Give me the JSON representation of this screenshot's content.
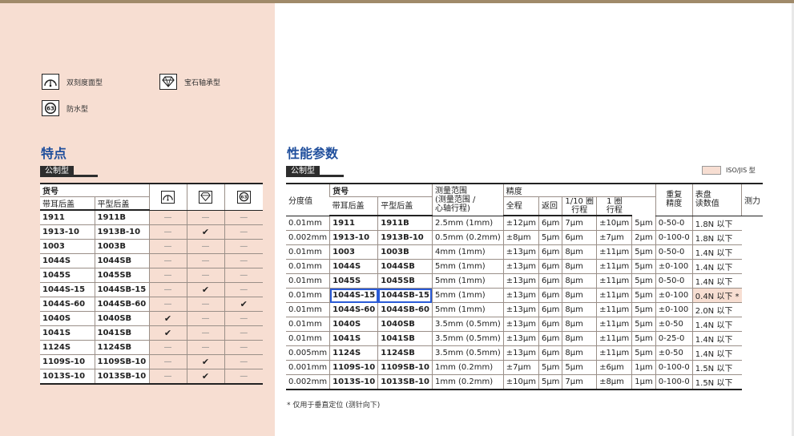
{
  "legend": {
    "dual": "双刻度面型",
    "jewel": "宝石轴承型",
    "water": "防水型"
  },
  "features": {
    "title": "特点",
    "tag": "公制型",
    "headers": {
      "part_no": "货号",
      "lug_back": "带耳后盖",
      "flat_back": "平型后盖"
    },
    "rows": [
      {
        "lug": "1911",
        "flat": "1911B",
        "dual": "—",
        "jewel": "—",
        "water": "—"
      },
      {
        "lug": "1913-10",
        "flat": "1913B-10",
        "dual": "—",
        "jewel": "✔",
        "water": "—"
      },
      {
        "lug": "1003",
        "flat": "1003B",
        "dual": "—",
        "jewel": "—",
        "water": "—"
      },
      {
        "lug": "1044S",
        "flat": "1044SB",
        "dual": "—",
        "jewel": "—",
        "water": "—"
      },
      {
        "lug": "1045S",
        "flat": "1045SB",
        "dual": "—",
        "jewel": "—",
        "water": "—"
      },
      {
        "lug": "1044S-15",
        "flat": "1044SB-15",
        "dual": "—",
        "jewel": "✔",
        "water": "—"
      },
      {
        "lug": "1044S-60",
        "flat": "1044SB-60",
        "dual": "—",
        "jewel": "—",
        "water": "✔"
      },
      {
        "lug": "1040S",
        "flat": "1040SB",
        "dual": "✔",
        "jewel": "—",
        "water": "—"
      },
      {
        "lug": "1041S",
        "flat": "1041SB",
        "dual": "✔",
        "jewel": "—",
        "water": "—"
      },
      {
        "lug": "1124S",
        "flat": "1124SB",
        "dual": "—",
        "jewel": "—",
        "water": "—"
      },
      {
        "lug": "1109S-10",
        "flat": "1109SB-10",
        "dual": "—",
        "jewel": "✔",
        "water": "—"
      },
      {
        "lug": "1013S-10",
        "flat": "1013SB-10",
        "dual": "—",
        "jewel": "✔",
        "water": "—"
      }
    ]
  },
  "specs": {
    "title": "性能参数",
    "tag": "公制型",
    "iso_legend": "ISO/JIS 型",
    "headers": {
      "graduation": "分度值",
      "part_no": "货号",
      "lug_back": "带耳后盖",
      "flat_back": "平型后盖",
      "range_l1": "测量范围",
      "range_l2": "(测量范围 /",
      "range_l3": "心轴行程)",
      "accuracy": "精度",
      "total": "全程",
      "retrace": "返回",
      "tenth_l1": "1/10 圈",
      "tenth_l2": "行程",
      "one_l1": "1 圈",
      "one_l2": "行程",
      "repeat_l1": "重复",
      "repeat_l2": "精度",
      "dial_l1": "表盘",
      "dial_l2": "读数值",
      "force": "测力"
    },
    "rows": [
      {
        "grad": "0.01mm",
        "lug": "1911",
        "flat": "1911B",
        "range": "2.5mm (1mm)",
        "total": "±12μm",
        "ret": "6μm",
        "tenth": "7μm",
        "one": "±10μm",
        "rep": "5μm",
        "dial": "0-50-0",
        "force": "1.8N 以下"
      },
      {
        "grad": "0.002mm",
        "lug": "1913-10",
        "flat": "1913B-10",
        "range": "0.5mm (0.2mm)",
        "total": "±8μm",
        "ret": "5μm",
        "tenth": "6μm",
        "one": "±7μm",
        "rep": "2μm",
        "dial": "0-100-0",
        "force": "1.8N 以下"
      },
      {
        "grad": "0.01mm",
        "lug": "1003",
        "flat": "1003B",
        "range": "4mm (1mm)",
        "total": "±13μm",
        "ret": "6μm",
        "tenth": "8μm",
        "one": "±11μm",
        "rep": "5μm",
        "dial": "0-50-0",
        "force": "1.4N 以下"
      },
      {
        "grad": "0.01mm",
        "lug": "1044S",
        "flat": "1044SB",
        "range": "5mm (1mm)",
        "total": "±13μm",
        "ret": "6μm",
        "tenth": "8μm",
        "one": "±11μm",
        "rep": "5μm",
        "dial": "±0-100",
        "force": "1.4N 以下"
      },
      {
        "grad": "0.01mm",
        "lug": "1045S",
        "flat": "1045SB",
        "range": "5mm (1mm)",
        "total": "±13μm",
        "ret": "6μm",
        "tenth": "8μm",
        "one": "±11μm",
        "rep": "5μm",
        "dial": "0-50-0",
        "force": "1.4N 以下"
      },
      {
        "grad": "0.01mm",
        "lug": "1044S-15",
        "flat": "1044SB-15",
        "range": "5mm (1mm)",
        "total": "±13μm",
        "ret": "6μm",
        "tenth": "8μm",
        "one": "±11μm",
        "rep": "5μm",
        "dial": "±0-100",
        "force": "0.4N 以下 *"
      },
      {
        "grad": "0.01mm",
        "lug": "1044S-60",
        "flat": "1044SB-60",
        "range": "5mm (1mm)",
        "total": "±13μm",
        "ret": "6μm",
        "tenth": "8μm",
        "one": "±11μm",
        "rep": "5μm",
        "dial": "±0-100",
        "force": "2.0N 以下"
      },
      {
        "grad": "0.01mm",
        "lug": "1040S",
        "flat": "1040SB",
        "range": "3.5mm (0.5mm)",
        "total": "±13μm",
        "ret": "6μm",
        "tenth": "8μm",
        "one": "±11μm",
        "rep": "5μm",
        "dial": "±0-50",
        "force": "1.4N 以下"
      },
      {
        "grad": "0.01mm",
        "lug": "1041S",
        "flat": "1041SB",
        "range": "3.5mm (0.5mm)",
        "total": "±13μm",
        "ret": "6μm",
        "tenth": "8μm",
        "one": "±11μm",
        "rep": "5μm",
        "dial": "0-25-0",
        "force": "1.4N 以下"
      },
      {
        "grad": "0.005mm",
        "lug": "1124S",
        "flat": "1124SB",
        "range": "3.5mm (0.5mm)",
        "total": "±13μm",
        "ret": "6μm",
        "tenth": "8μm",
        "one": "±11μm",
        "rep": "5μm",
        "dial": "±0-50",
        "force": "1.4N 以下"
      },
      {
        "grad": "0.001mm",
        "lug": "1109S-10",
        "flat": "1109SB-10",
        "range": "1mm (0.2mm)",
        "total": "±7μm",
        "ret": "5μm",
        "tenth": "5μm",
        "one": "±6μm",
        "rep": "1μm",
        "dial": "0-100-0",
        "force": "1.5N 以下"
      },
      {
        "grad": "0.002mm",
        "lug": "1013S-10",
        "flat": "1013SB-10",
        "range": "1mm (0.2mm)",
        "total": "±10μm",
        "ret": "5μm",
        "tenth": "7μm",
        "one": "±8μm",
        "rep": "1μm",
        "dial": "0-100-0",
        "force": "1.5N 以下"
      }
    ],
    "footnote": "* 仅用于垂直定位 (测针向下)"
  },
  "colors": {
    "panel": "#f7ded2",
    "title": "#1f4e9c",
    "highlight": "#2a5bd7"
  }
}
